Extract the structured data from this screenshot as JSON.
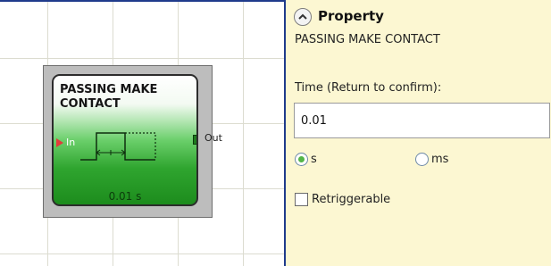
{
  "canvas": {
    "block": {
      "title_line1": "PASSING MAKE",
      "title_line2": "CONTACT",
      "input_label": "In",
      "output_label": "Out",
      "time_text": "0.01 s"
    }
  },
  "panel": {
    "title": "Property",
    "block_name": "PASSING MAKE CONTACT",
    "time_label": "Time (Return to confirm):",
    "time_value": "0.01",
    "unit_options": [
      {
        "label": "s",
        "checked": true
      },
      {
        "label": "ms",
        "checked": false
      }
    ],
    "retriggerable": {
      "label": "Retriggerable",
      "checked": false
    }
  },
  "colors": {
    "panel_bg": "#fcf7d2",
    "block_green": "#2fa52f",
    "border_blue": "#1f3b8c",
    "input_pin": "#e23b3b",
    "output_pin": "#1e7a1e"
  },
  "icons": {
    "collapse": "chevron-up-icon",
    "timing": "pulse-timing-diagram-icon"
  }
}
